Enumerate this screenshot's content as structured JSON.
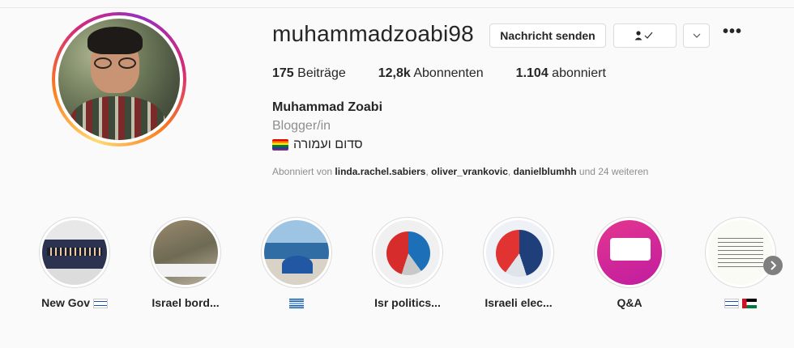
{
  "profile": {
    "username": "muhammadzoabi98",
    "full_name": "Muhammad Zoabi",
    "category": "Blogger/in",
    "bio": "סדום ועמורה",
    "bio_emoji": "rainbow-flag"
  },
  "actions": {
    "message_label": "Nachricht senden",
    "follow_icon": "person-check-icon",
    "chevron_label": "⌄",
    "more_label": "•••"
  },
  "stats": {
    "posts_count": "175",
    "posts_label": "Beiträge",
    "followers_count": "12,8k",
    "followers_label": "Abonnenten",
    "following_count": "1.104",
    "following_label": "abonniert"
  },
  "followed_by": {
    "prefix": "Abonniert von",
    "users": [
      "linda.rachel.sabiers",
      "oliver_vrankovic",
      "danielblumhh"
    ],
    "suffix": "und 24 weiteren"
  },
  "highlights": [
    {
      "label": "New Gov",
      "flag": "israel"
    },
    {
      "label": "Israel bord...",
      "flag": ""
    },
    {
      "label": "",
      "flag": "greece"
    },
    {
      "label": "Isr politics...",
      "flag": ""
    },
    {
      "label": "Israeli elec...",
      "flag": ""
    },
    {
      "label": "Q&A",
      "flag": ""
    },
    {
      "label": "",
      "flag": "israel-palestine"
    }
  ],
  "colors": {
    "background": "#fafafa",
    "text": "#262626",
    "muted": "#8e8e8e",
    "border": "#dbdbdb"
  }
}
